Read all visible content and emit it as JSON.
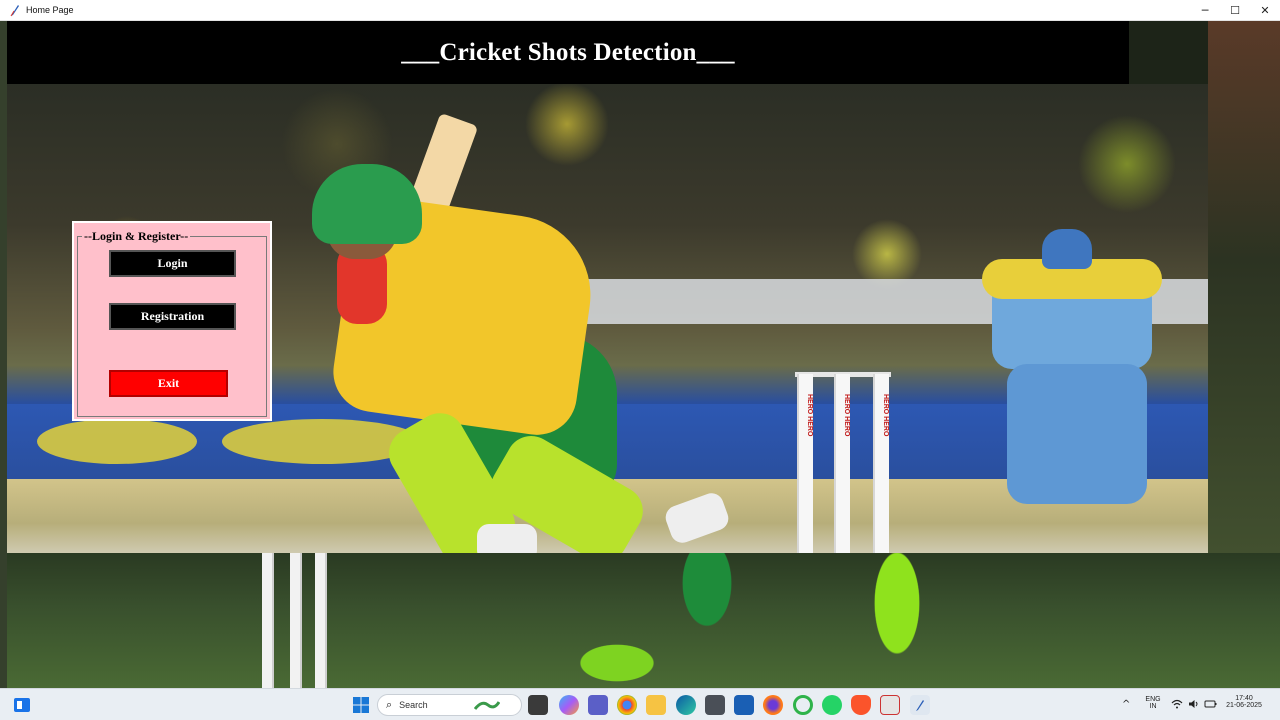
{
  "window": {
    "title": "Home Page",
    "controls": {
      "minimize": "─",
      "maximize": "☐",
      "close": "✕"
    }
  },
  "header": {
    "title": "___Cricket Shots Detection___"
  },
  "login_panel": {
    "legend": "--Login & Register--",
    "login_label": "Login",
    "registration_label": "Registration",
    "exit_label": "Exit"
  },
  "background": {
    "wicket_text": "HERO HERO"
  },
  "taskbar": {
    "search_placeholder": "Search",
    "search_icon": "⌕",
    "language_top": "ENG",
    "language_bottom": "IN",
    "time": "17:40",
    "date": "21-06-2025",
    "tray_chevron": "^",
    "icons": {
      "wifi": "wifi-icon",
      "volume": "volume-icon",
      "battery": "battery-icon"
    }
  },
  "colors": {
    "panel_bg": "#ffc0cb",
    "header_bg": "#000000",
    "exit_button": "#ff0000",
    "button_black": "#000000"
  }
}
